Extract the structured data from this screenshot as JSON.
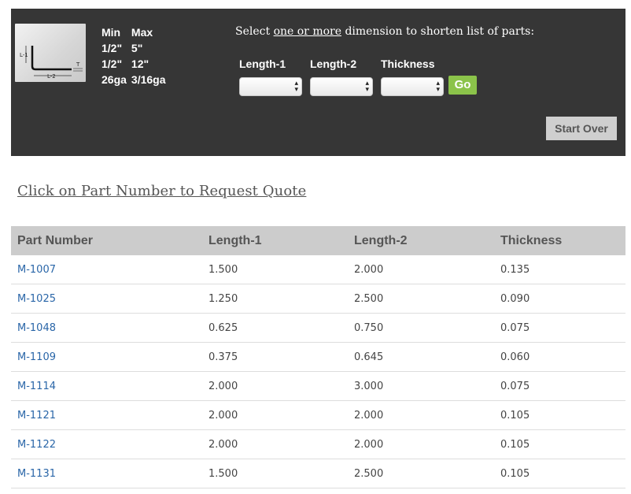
{
  "spec_table": {
    "headers": [
      "Min",
      "Max"
    ],
    "rows": [
      [
        "1/2\"",
        "5\""
      ],
      [
        "1/2\"",
        "12\""
      ],
      [
        "26ga",
        "3/16ga"
      ]
    ]
  },
  "diagram": {
    "label_l1": "L-1",
    "label_l2": "L-2",
    "label_t": "T"
  },
  "filter": {
    "instruction_pre": "Select ",
    "instruction_link": "one or more",
    "instruction_post": " dimension to shorten list of parts:",
    "labels": [
      "Length-1",
      "Length-2",
      "Thickness"
    ],
    "go_label": "Go",
    "start_over_label": "Start Over"
  },
  "quote_link": "Click on Part Number to Request Quote",
  "parts_table": {
    "columns": [
      "Part Number",
      "Length-1",
      "Length-2",
      "Thickness"
    ],
    "rows": [
      [
        "M-1007",
        "1.500",
        "2.000",
        "0.135"
      ],
      [
        "M-1025",
        "1.250",
        "2.500",
        "0.090"
      ],
      [
        "M-1048",
        "0.625",
        "0.750",
        "0.075"
      ],
      [
        "M-1109",
        "0.375",
        "0.645",
        "0.060"
      ],
      [
        "M-1114",
        "2.000",
        "3.000",
        "0.075"
      ],
      [
        "M-1121",
        "2.000",
        "2.000",
        "0.105"
      ],
      [
        "M-1122",
        "2.000",
        "2.000",
        "0.105"
      ],
      [
        "M-1131",
        "1.500",
        "2.500",
        "0.105"
      ]
    ]
  },
  "colors": {
    "panel": "#363636",
    "go": "#8bc34a",
    "link": "#2a66a8",
    "header_row": "#cccccc"
  }
}
